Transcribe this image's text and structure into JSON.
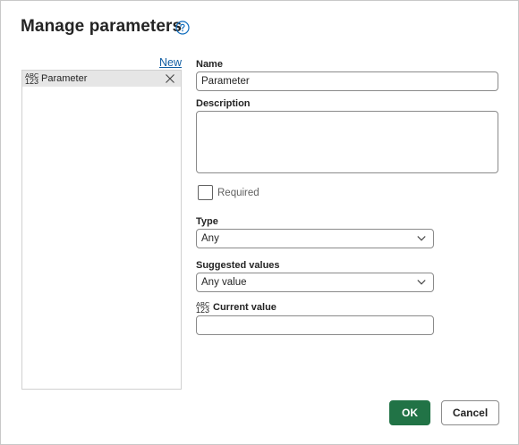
{
  "dialog": {
    "title": "Manage parameters",
    "help_icon": "question-circle-icon"
  },
  "list": {
    "new_label": "New",
    "items": [
      {
        "type_top": "ABC",
        "type_bottom": "123",
        "label": "Parameter",
        "remove_icon": "close-icon"
      }
    ]
  },
  "form": {
    "name_label": "Name",
    "name_value": "Parameter",
    "description_label": "Description",
    "description_value": "",
    "required_label": "Required",
    "required_checked": false,
    "type_label": "Type",
    "type_value": "Any",
    "suggested_label": "Suggested values",
    "suggested_value": "Any value",
    "current_type_top": "ABC",
    "current_type_bottom": "123",
    "current_label": "Current value",
    "current_value": ""
  },
  "buttons": {
    "ok": "OK",
    "cancel": "Cancel"
  },
  "colors": {
    "primary": "#217346",
    "link": "#115ea3"
  }
}
